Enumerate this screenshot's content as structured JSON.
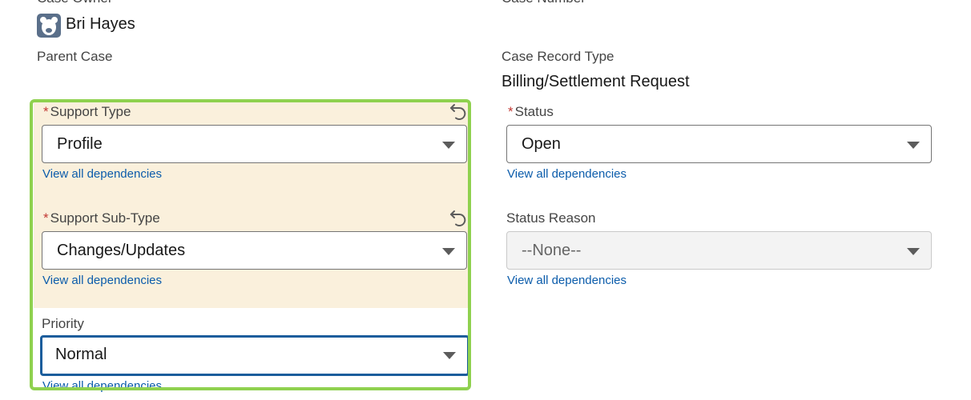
{
  "top": {
    "owner_label": "Case Owner",
    "owner_name": "Bri Hayes",
    "number_label": "Case Number"
  },
  "left": {
    "parent_case_label": "Parent Case",
    "parent_case_value": "",
    "support_type": {
      "label": "Support Type",
      "value": "Profile",
      "dependencies_link": "View all dependencies"
    },
    "support_sub_type": {
      "label": "Support Sub-Type",
      "value": "Changes/Updates",
      "dependencies_link": "View all dependencies"
    },
    "priority": {
      "label": "Priority",
      "value": "Normal",
      "dependencies_link": "View all dependencies"
    }
  },
  "right": {
    "record_type_label": "Case Record Type",
    "record_type_value": "Billing/Settlement Request",
    "status": {
      "label": "Status",
      "value": "Open",
      "dependencies_link": "View all dependencies"
    },
    "status_reason": {
      "label": "Status Reason",
      "value": "--None--",
      "dependencies_link": "View all dependencies"
    }
  },
  "required_marker": "*",
  "colors": {
    "edited_background": "#faf0dc",
    "highlight_border": "#8fd14f",
    "focus_border": "#1b5d9c",
    "link": "#0b5cab",
    "required": "#c23934"
  },
  "icons": {
    "owner_avatar": "bear-avatar-icon",
    "undo": "undo-icon",
    "dropdown": "chevron-down-icon"
  }
}
